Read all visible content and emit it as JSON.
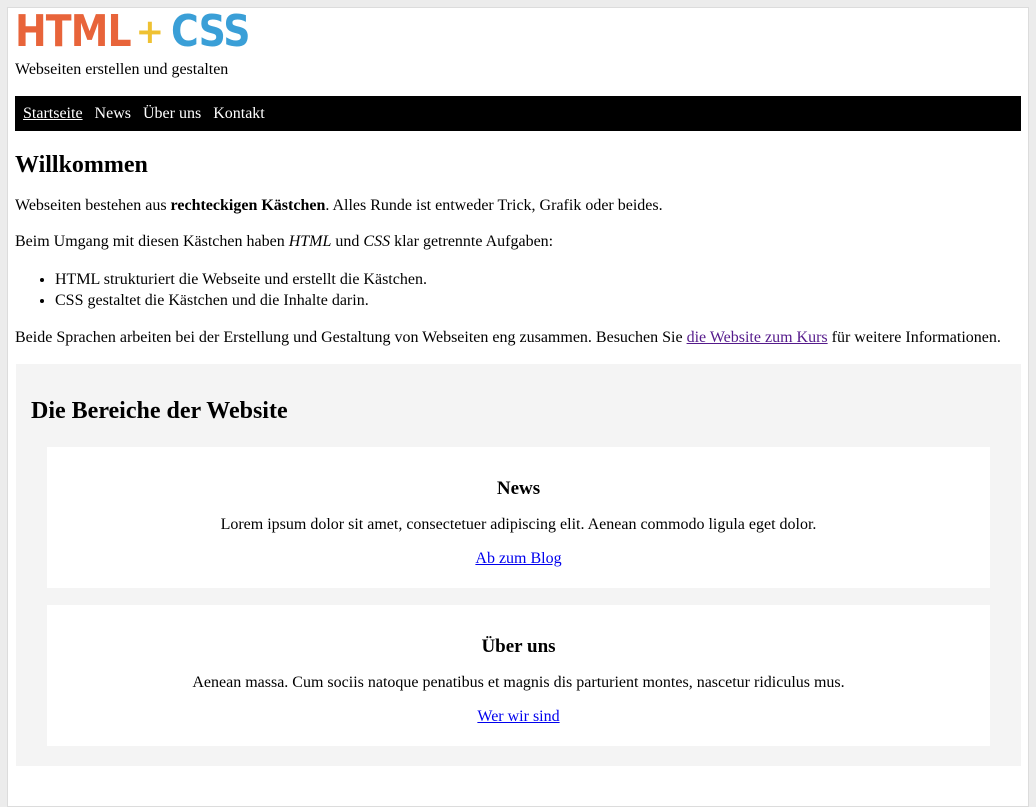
{
  "header": {
    "logo": {
      "part1": "HTML",
      "plus": "+",
      "part2": "CSS",
      "colors": {
        "html": "#e8643a",
        "plus": "#efc132",
        "css": "#3a9fd7"
      }
    },
    "tagline": "Webseiten erstellen und gestalten"
  },
  "nav": {
    "items": [
      {
        "label": "Startseite",
        "active": true
      },
      {
        "label": "News",
        "active": false
      },
      {
        "label": "Über uns",
        "active": false
      },
      {
        "label": "Kontakt",
        "active": false
      }
    ]
  },
  "main": {
    "title": "Willkommen",
    "intro": {
      "before": "Webseiten bestehen aus ",
      "bold": "rechteckigen Kästchen",
      "after": ". Alles Runde ist entweder Trick, Grafik oder beides."
    },
    "tasks": {
      "before": "Beim Umgang mit diesen Kästchen haben ",
      "em1": "HTML",
      "middle": " und ",
      "em2": "CSS",
      "after": " klar getrennte Aufgaben:"
    },
    "list": [
      "HTML strukturiert die Webseite und erstellt die Kästchen.",
      "CSS gestaltet die Kästchen und die Inhalte darin."
    ],
    "closing": {
      "before": "Beide Sprachen arbeiten bei der Erstellung und Gestaltung von Webseiten eng zusammen. Besuchen Sie ",
      "link": "die Website zum Kurs",
      "after": " für weitere Informationen."
    }
  },
  "section": {
    "title": "Die Bereiche der Website",
    "cards": [
      {
        "title": "News",
        "text": "Lorem ipsum dolor sit amet, consectetuer adipiscing elit. Aenean commodo ligula eget dolor.",
        "link": "Ab zum Blog"
      },
      {
        "title": "Über uns",
        "text": "Aenean massa. Cum sociis natoque penatibus et magnis dis parturient montes, nascetur ridiculus mus.",
        "link": "Wer wir sind"
      }
    ]
  },
  "colors": {
    "nav_bg": "#000000",
    "section_bg": "#f4f4f4",
    "link": "#0000ee",
    "link_visited": "#551a8b"
  }
}
